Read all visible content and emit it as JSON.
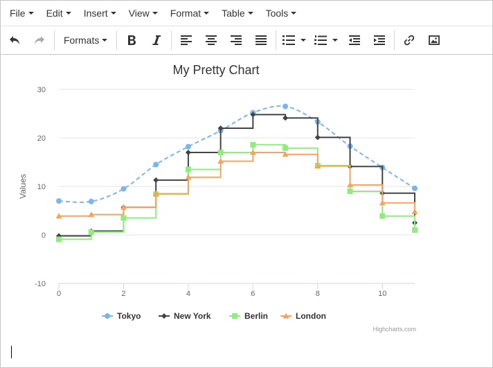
{
  "menubar": {
    "items": [
      "File",
      "Edit",
      "Insert",
      "View",
      "Format",
      "Table",
      "Tools"
    ]
  },
  "toolbar": {
    "formats_label": "Formats",
    "icons": [
      "undo-icon",
      "redo-icon",
      "bold-icon",
      "italic-icon",
      "align-left-icon",
      "align-center-icon",
      "align-right-icon",
      "align-justify-icon",
      "bullet-list-icon",
      "numbered-list-icon",
      "outdent-icon",
      "indent-icon",
      "link-icon",
      "image-icon"
    ]
  },
  "credit": "Highcharts.com",
  "chart_data": {
    "type": "line",
    "title": "My Pretty Chart",
    "ylabel": "Values",
    "xlabel": "",
    "xlim": [
      0,
      11
    ],
    "ylim": [
      -10,
      30
    ],
    "x_ticks": [
      0,
      2,
      4,
      6,
      8,
      10
    ],
    "y_ticks": [
      -10,
      0,
      10,
      20,
      30
    ],
    "grid": true,
    "legend_position": "bottom",
    "x": [
      0,
      1,
      2,
      3,
      4,
      5,
      6,
      7,
      8,
      9,
      10,
      11
    ],
    "series": [
      {
        "name": "Tokyo",
        "style": "dashed-spline",
        "marker": "circle",
        "color": "#7cb5ec",
        "values": [
          7.0,
          6.9,
          9.5,
          14.5,
          18.2,
          21.5,
          25.2,
          26.5,
          23.3,
          18.3,
          13.9,
          9.6
        ]
      },
      {
        "name": "New York",
        "style": "step",
        "marker": "diamond",
        "color": "#434348",
        "values": [
          -0.2,
          0.8,
          5.7,
          11.3,
          17.0,
          22.0,
          24.8,
          24.1,
          20.1,
          14.1,
          8.6,
          2.5
        ]
      },
      {
        "name": "Berlin",
        "style": "step",
        "marker": "square",
        "color": "#90ed7d",
        "values": [
          -0.9,
          0.6,
          3.5,
          8.4,
          13.5,
          17.0,
          18.6,
          17.9,
          14.3,
          9.0,
          3.9,
          1.0
        ]
      },
      {
        "name": "London",
        "style": "step",
        "marker": "triangle",
        "color": "#f7a35c",
        "values": [
          3.9,
          4.2,
          5.7,
          8.5,
          11.9,
          15.2,
          17.0,
          16.6,
          14.2,
          10.3,
          6.6,
          4.8
        ]
      }
    ]
  }
}
